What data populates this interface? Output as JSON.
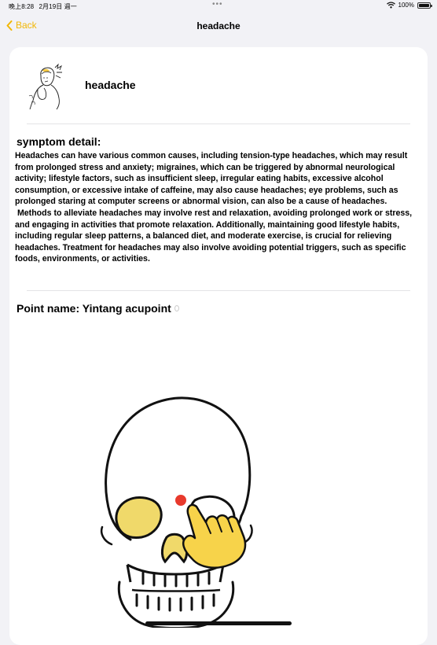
{
  "status_bar": {
    "time": "晚上8:28",
    "date": "2月19日 週一",
    "dots": "•••",
    "battery": "100%"
  },
  "nav": {
    "back_label": "Back",
    "title": "headache"
  },
  "symptom": {
    "name": "headache",
    "detail_heading": "symptom detail:",
    "detail_text": "Headaches can have various common causes, including tension-type headaches, which may result from prolonged stress and anxiety; migraines, which can be triggered by abnormal neurological activity; lifestyle factors, such as insufficient sleep, irregular eating habits, excessive alcohol consumption, or excessive intake of caffeine, may also cause headaches; eye problems, such as prolonged staring at computer screens or abnormal vision, can also be a cause of headaches.\n Methods to alleviate headaches may involve rest and relaxation, avoiding prolonged work or stress, and engaging in activities that promote relaxation. Additionally, maintaining good lifestyle habits, including regular sleep patterns, a balanced diet, and moderate exercise, is crucial for relieving headaches. Treatment for headaches may also involve avoiding potential triggers, such as specific foods, environments, or activities."
  },
  "acupoint": {
    "label": "Point name: Yintang acupoint"
  },
  "colors": {
    "accent": "#f2b705",
    "point_marker": "#e8392c",
    "highlight_yellow": "#f7d34a"
  },
  "icons": {
    "back": "chevron-left-icon",
    "wifi": "wifi-icon",
    "battery": "battery-icon"
  }
}
